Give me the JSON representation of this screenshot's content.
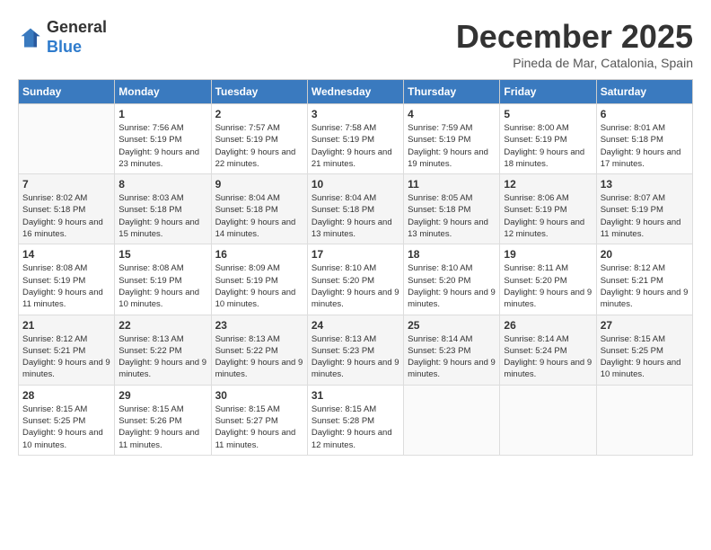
{
  "header": {
    "logo": {
      "line1": "General",
      "line2": "Blue"
    },
    "title": "December 2025",
    "location": "Pineda de Mar, Catalonia, Spain"
  },
  "weekdays": [
    "Sunday",
    "Monday",
    "Tuesday",
    "Wednesday",
    "Thursday",
    "Friday",
    "Saturday"
  ],
  "weeks": [
    [
      {
        "day": null
      },
      {
        "day": 1,
        "sunrise": "7:56 AM",
        "sunset": "5:19 PM",
        "daylight": "9 hours and 23 minutes."
      },
      {
        "day": 2,
        "sunrise": "7:57 AM",
        "sunset": "5:19 PM",
        "daylight": "9 hours and 22 minutes."
      },
      {
        "day": 3,
        "sunrise": "7:58 AM",
        "sunset": "5:19 PM",
        "daylight": "9 hours and 21 minutes."
      },
      {
        "day": 4,
        "sunrise": "7:59 AM",
        "sunset": "5:19 PM",
        "daylight": "9 hours and 19 minutes."
      },
      {
        "day": 5,
        "sunrise": "8:00 AM",
        "sunset": "5:19 PM",
        "daylight": "9 hours and 18 minutes."
      },
      {
        "day": 6,
        "sunrise": "8:01 AM",
        "sunset": "5:18 PM",
        "daylight": "9 hours and 17 minutes."
      }
    ],
    [
      {
        "day": 7,
        "sunrise": "8:02 AM",
        "sunset": "5:18 PM",
        "daylight": "9 hours and 16 minutes."
      },
      {
        "day": 8,
        "sunrise": "8:03 AM",
        "sunset": "5:18 PM",
        "daylight": "9 hours and 15 minutes."
      },
      {
        "day": 9,
        "sunrise": "8:04 AM",
        "sunset": "5:18 PM",
        "daylight": "9 hours and 14 minutes."
      },
      {
        "day": 10,
        "sunrise": "8:04 AM",
        "sunset": "5:18 PM",
        "daylight": "9 hours and 13 minutes."
      },
      {
        "day": 11,
        "sunrise": "8:05 AM",
        "sunset": "5:18 PM",
        "daylight": "9 hours and 13 minutes."
      },
      {
        "day": 12,
        "sunrise": "8:06 AM",
        "sunset": "5:19 PM",
        "daylight": "9 hours and 12 minutes."
      },
      {
        "day": 13,
        "sunrise": "8:07 AM",
        "sunset": "5:19 PM",
        "daylight": "9 hours and 11 minutes."
      }
    ],
    [
      {
        "day": 14,
        "sunrise": "8:08 AM",
        "sunset": "5:19 PM",
        "daylight": "9 hours and 11 minutes."
      },
      {
        "day": 15,
        "sunrise": "8:08 AM",
        "sunset": "5:19 PM",
        "daylight": "9 hours and 10 minutes."
      },
      {
        "day": 16,
        "sunrise": "8:09 AM",
        "sunset": "5:19 PM",
        "daylight": "9 hours and 10 minutes."
      },
      {
        "day": 17,
        "sunrise": "8:10 AM",
        "sunset": "5:20 PM",
        "daylight": "9 hours and 9 minutes."
      },
      {
        "day": 18,
        "sunrise": "8:10 AM",
        "sunset": "5:20 PM",
        "daylight": "9 hours and 9 minutes."
      },
      {
        "day": 19,
        "sunrise": "8:11 AM",
        "sunset": "5:20 PM",
        "daylight": "9 hours and 9 minutes."
      },
      {
        "day": 20,
        "sunrise": "8:12 AM",
        "sunset": "5:21 PM",
        "daylight": "9 hours and 9 minutes."
      }
    ],
    [
      {
        "day": 21,
        "sunrise": "8:12 AM",
        "sunset": "5:21 PM",
        "daylight": "9 hours and 9 minutes."
      },
      {
        "day": 22,
        "sunrise": "8:13 AM",
        "sunset": "5:22 PM",
        "daylight": "9 hours and 9 minutes."
      },
      {
        "day": 23,
        "sunrise": "8:13 AM",
        "sunset": "5:22 PM",
        "daylight": "9 hours and 9 minutes."
      },
      {
        "day": 24,
        "sunrise": "8:13 AM",
        "sunset": "5:23 PM",
        "daylight": "9 hours and 9 minutes."
      },
      {
        "day": 25,
        "sunrise": "8:14 AM",
        "sunset": "5:23 PM",
        "daylight": "9 hours and 9 minutes."
      },
      {
        "day": 26,
        "sunrise": "8:14 AM",
        "sunset": "5:24 PM",
        "daylight": "9 hours and 9 minutes."
      },
      {
        "day": 27,
        "sunrise": "8:15 AM",
        "sunset": "5:25 PM",
        "daylight": "9 hours and 10 minutes."
      }
    ],
    [
      {
        "day": 28,
        "sunrise": "8:15 AM",
        "sunset": "5:25 PM",
        "daylight": "9 hours and 10 minutes."
      },
      {
        "day": 29,
        "sunrise": "8:15 AM",
        "sunset": "5:26 PM",
        "daylight": "9 hours and 11 minutes."
      },
      {
        "day": 30,
        "sunrise": "8:15 AM",
        "sunset": "5:27 PM",
        "daylight": "9 hours and 11 minutes."
      },
      {
        "day": 31,
        "sunrise": "8:15 AM",
        "sunset": "5:28 PM",
        "daylight": "9 hours and 12 minutes."
      },
      {
        "day": null
      },
      {
        "day": null
      },
      {
        "day": null
      }
    ]
  ],
  "labels": {
    "sunrise": "Sunrise:",
    "sunset": "Sunset:",
    "daylight": "Daylight:"
  }
}
